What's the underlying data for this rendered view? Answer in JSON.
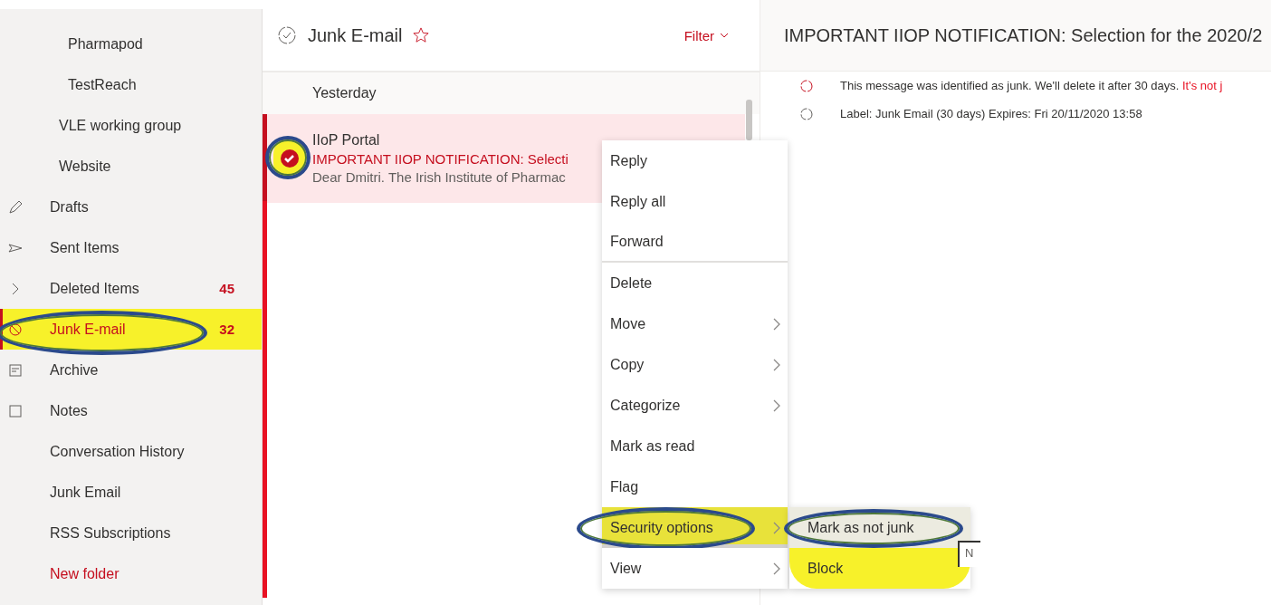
{
  "sidebar": {
    "items": [
      {
        "children": [
          {
            "children": [
              {
                "label": "Pharmapod",
                "selected": false
              },
              {
                "label": "TestReach",
                "selected": false
              }
            ]
          },
          {
            "label": "VLE working group",
            "selected": false
          },
          {
            "label": "Website",
            "selected": false
          }
        ]
      },
      {
        "label": "Drafts",
        "selected": false
      },
      {
        "label": "Sent Items",
        "selected": false
      },
      {
        "label": "Deleted Items",
        "count": "45",
        "selected": false
      },
      {
        "label": "Junk E-mail",
        "count": "32",
        "selected": true,
        "highlighted": true,
        "circled": true
      },
      {
        "label": "Archive",
        "selected": false
      },
      {
        "label": "Notes",
        "selected": false
      },
      {
        "label": "Conversation History",
        "selected": false
      },
      {
        "label": "Junk Email",
        "selected": false
      },
      {
        "label": "RSS Subscriptions",
        "selected": false
      },
      {
        "label": "New folder",
        "kind": "action",
        "selected": false
      }
    ]
  },
  "message_list": {
    "title": "Junk E-mail",
    "favorite": false,
    "filter": "Filter",
    "group": "Yesterday",
    "messages": [
      {
        "sender": "IIoP Portal",
        "subject": "IMPORTANT IIOP NOTIFICATION: Selecti",
        "preview": "Dear Dmitri. The Irish Institute of Pharmac",
        "checked": true,
        "selected": true,
        "highlighted": true,
        "circled": true
      }
    ]
  },
  "reading_pane": {
    "title": "IMPORTANT IIOP NOTIFICATION: Selection for the 2020/2",
    "notices": [
      {
        "kind": "junk",
        "text": "This message was identified as junk. We'll delete it after 30 days.",
        "link": "It's not j"
      },
      {
        "kind": "label",
        "text": "Label: Junk Email (30 days) Expires: Fri 20/11/2020 13:58"
      }
    ]
  },
  "context_menu": {
    "items": [
      {
        "label": "Reply",
        "submenu": false,
        "selected": false
      },
      {
        "label": "Reply all",
        "submenu": false,
        "selected": false
      },
      {
        "label": "Forward",
        "submenu": false,
        "selected": false,
        "divider_after": true
      },
      {
        "label": "Delete",
        "submenu": false,
        "selected": false
      },
      {
        "label": "Move",
        "submenu": true,
        "selected": false
      },
      {
        "label": "Copy",
        "submenu": true,
        "selected": false
      },
      {
        "label": "Categorize",
        "submenu": true,
        "selected": false
      },
      {
        "label": "Mark as read",
        "submenu": false,
        "selected": false
      },
      {
        "label": "Flag",
        "submenu": false,
        "selected": false
      },
      {
        "label": "Security options",
        "submenu": true,
        "selected": true,
        "highlighted": true,
        "circled": true
      },
      {
        "label": "View",
        "submenu": true,
        "selected": false
      }
    ],
    "submenu": {
      "items": [
        {
          "label": "Mark as not junk",
          "selected": true,
          "highlighted": true,
          "circled": true
        },
        {
          "label": "Block",
          "selected": false,
          "highlighted": true
        }
      ],
      "tooltip": "N"
    }
  }
}
